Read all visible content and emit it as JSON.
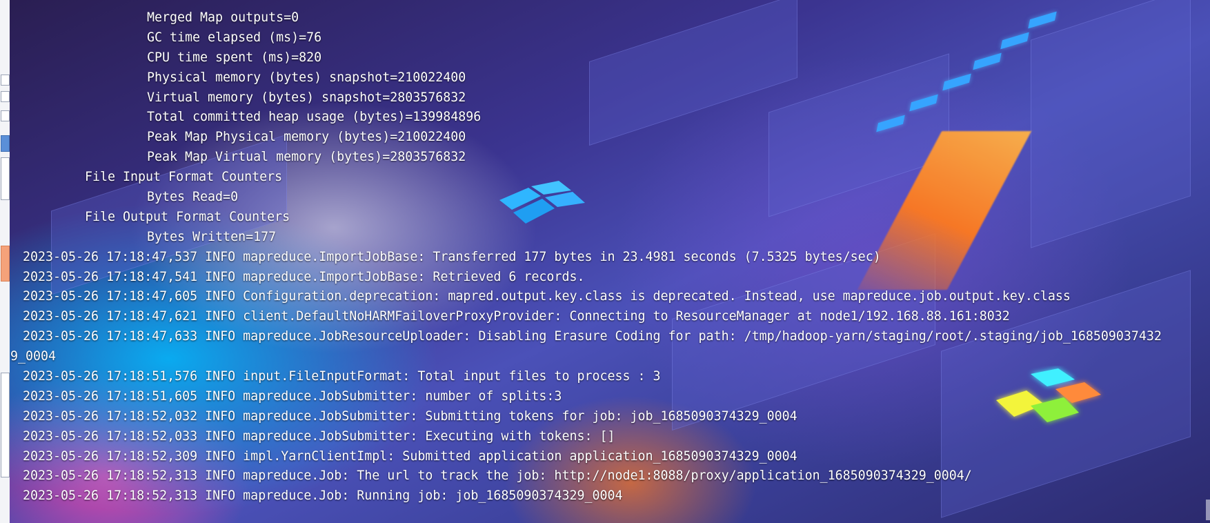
{
  "terminal": {
    "lines": [
      {
        "indent": 2,
        "text": "Merged Map outputs=0"
      },
      {
        "indent": 2,
        "text": "GC time elapsed (ms)=76"
      },
      {
        "indent": 2,
        "text": "CPU time spent (ms)=820"
      },
      {
        "indent": 2,
        "text": "Physical memory (bytes) snapshot=210022400"
      },
      {
        "indent": 2,
        "text": "Virtual memory (bytes) snapshot=2803576832"
      },
      {
        "indent": 2,
        "text": "Total committed heap usage (bytes)=139984896"
      },
      {
        "indent": 2,
        "text": "Peak Map Physical memory (bytes)=210022400"
      },
      {
        "indent": 2,
        "text": "Peak Map Virtual memory (bytes)=2803576832"
      },
      {
        "indent": 1,
        "text": "File Input Format Counters"
      },
      {
        "indent": 2,
        "text": "Bytes Read=0"
      },
      {
        "indent": 1,
        "text": "File Output Format Counters"
      },
      {
        "indent": 2,
        "text": "Bytes Written=177"
      },
      {
        "indent": 0,
        "text": "2023-05-26 17:18:47,537 INFO mapreduce.ImportJobBase: Transferred 177 bytes in 23.4981 seconds (7.5325 bytes/sec)"
      },
      {
        "indent": 0,
        "text": "2023-05-26 17:18:47,541 INFO mapreduce.ImportJobBase: Retrieved 6 records."
      },
      {
        "indent": 0,
        "text": "2023-05-26 17:18:47,605 INFO Configuration.deprecation: mapred.output.key.class is deprecated. Instead, use mapreduce.job.output.key.class"
      },
      {
        "indent": 0,
        "text": "2023-05-26 17:18:47,621 INFO client.DefaultNoHARMFailoverProxyProvider: Connecting to ResourceManager at node1/192.168.88.161:8032"
      },
      {
        "indent": 0,
        "text": "2023-05-26 17:18:47,633 INFO mapreduce.JobResourceUploader: Disabling Erasure Coding for path: /tmp/hadoop-yarn/staging/root/.staging/job_168509037432"
      },
      {
        "indent": 0,
        "text": "9_0004"
      },
      {
        "indent": 0,
        "text": "2023-05-26 17:18:51,576 INFO input.FileInputFormat: Total input files to process : 3"
      },
      {
        "indent": 0,
        "text": "2023-05-26 17:18:51,605 INFO mapreduce.JobSubmitter: number of splits:3"
      },
      {
        "indent": 0,
        "text": "2023-05-26 17:18:52,032 INFO mapreduce.JobSubmitter: Submitting tokens for job: job_1685090374329_0004"
      },
      {
        "indent": 0,
        "text": "2023-05-26 17:18:52,033 INFO mapreduce.JobSubmitter: Executing with tokens: []"
      },
      {
        "indent": 0,
        "text": "2023-05-26 17:18:52,309 INFO impl.YarnClientImpl: Submitted application application_1685090374329_0004"
      },
      {
        "indent": 0,
        "text": "2023-05-26 17:18:52,313 INFO mapreduce.Job: The url to track the job: http://node1:8088/proxy/application_1685090374329_0004/"
      },
      {
        "indent": 0,
        "text": "2023-05-26 17:18:52,313 INFO mapreduce.Job: Running job: job_1685090374329_0004"
      }
    ]
  },
  "colors": {
    "text": "#ffffff",
    "accent_orange": "#ff7a1e",
    "accent_blue": "#36a4ff"
  },
  "icons": {
    "center_logo": "windows-logo-icon",
    "corner_logo": "colorful-windows-logo-icon"
  }
}
